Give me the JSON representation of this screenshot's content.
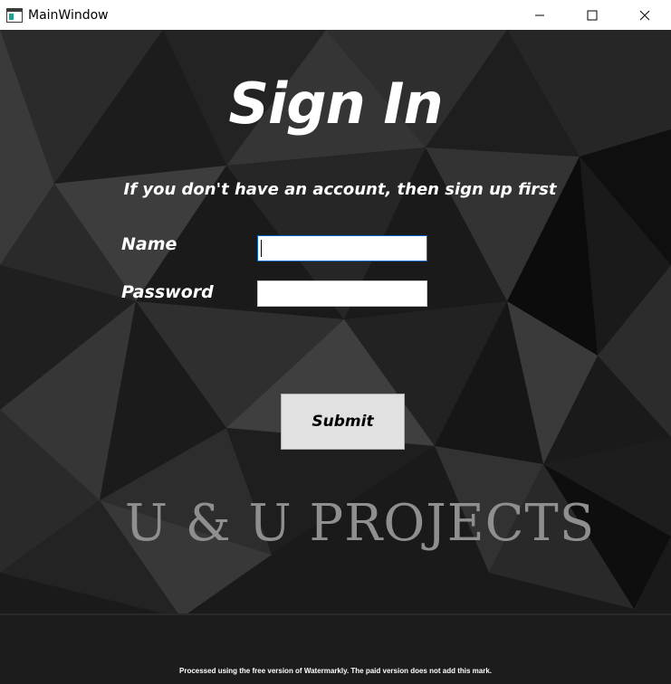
{
  "window": {
    "title": "MainWindow",
    "app_icon": "app-window-icon",
    "controls": {
      "minimize_icon": "minimize-icon",
      "maximize_icon": "maximize-icon",
      "close_icon": "close-icon"
    }
  },
  "form": {
    "heading": "Sign In",
    "subtitle": "If you don't have an account, then sign up first",
    "name_label": "Name",
    "name_value": "",
    "password_label": "Password",
    "password_value": "",
    "submit_label": "Submit"
  },
  "branding": {
    "text": "U & U PROJECTS"
  },
  "watermark": {
    "text": "Processed using the free version of Watermarkly. The paid version does not add this mark."
  },
  "colors": {
    "background": "#161616",
    "text": "#ffffff",
    "button": "#e1e1e1",
    "brand_text": "#8f8f8f",
    "input_focus_border": "#0a64c8"
  }
}
